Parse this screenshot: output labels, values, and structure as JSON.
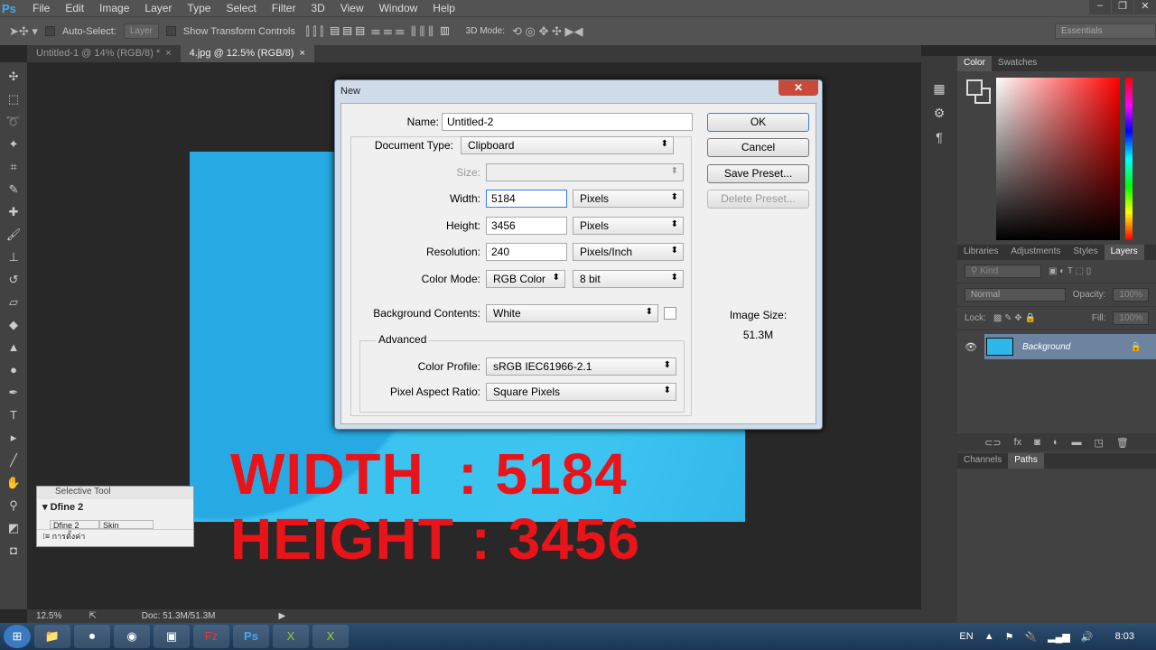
{
  "app": {
    "logo": "Ps",
    "menu": [
      "File",
      "Edit",
      "Image",
      "Layer",
      "Type",
      "Select",
      "Filter",
      "3D",
      "View",
      "Window",
      "Help"
    ]
  },
  "options": {
    "auto_select": "Auto-Select:",
    "layer": "Layer",
    "show_transform": "Show Transform Controls",
    "mode_3d": "3D Mode:",
    "workspace": "Essentials"
  },
  "tabs": [
    {
      "label": "Untitled-1 @ 14% (RGB/8) *"
    },
    {
      "label": "4.jpg @ 12.5% (RGB/8)"
    }
  ],
  "overlay": {
    "line1": "WIDTH  : 5184",
    "line2": "HEIGHT : 3456"
  },
  "status": {
    "zoom": "12.5%",
    "doc": "Doc: 51.3M/51.3M"
  },
  "selective": {
    "title": "Selective Tool",
    "section": "Dfine 2",
    "cols": [
      "Dfine 2",
      "Skin"
    ],
    "footer": "การตั้งค่า"
  },
  "dialog": {
    "title": "New",
    "name_label": "Name:",
    "name": "Untitled-2",
    "doc_type_label": "Document Type:",
    "doc_type": "Clipboard",
    "size_label": "Size:",
    "width_label": "Width:",
    "width": "5184",
    "width_unit": "Pixels",
    "height_label": "Height:",
    "height": "3456",
    "height_unit": "Pixels",
    "res_label": "Resolution:",
    "res": "240",
    "res_unit": "Pixels/Inch",
    "mode_label": "Color Mode:",
    "mode": "RGB Color",
    "depth": "8 bit",
    "bg_label": "Background Contents:",
    "bg": "White",
    "advanced": "Advanced",
    "profile_label": "Color Profile:",
    "profile": "sRGB IEC61966-2.1",
    "par_label": "Pixel Aspect Ratio:",
    "par": "Square Pixels",
    "ok": "OK",
    "cancel": "Cancel",
    "save_preset": "Save Preset...",
    "delete_preset": "Delete Preset...",
    "image_size_label": "Image Size:",
    "image_size": "51.3M"
  },
  "color_panel": {
    "tabs": [
      "Color",
      "Swatches"
    ]
  },
  "layers_panel": {
    "tabs": [
      "Libraries",
      "Adjustments",
      "Styles",
      "Layers"
    ],
    "kind": "Kind",
    "blend": "Normal",
    "opacity_label": "Opacity:",
    "opacity": "100%",
    "lock_label": "Lock:",
    "fill_label": "Fill:",
    "fill": "100%",
    "layer": "Background"
  },
  "paths_panel": {
    "tabs": [
      "Channels",
      "Paths"
    ]
  },
  "tray": {
    "lang": "EN",
    "time": "8:03"
  }
}
